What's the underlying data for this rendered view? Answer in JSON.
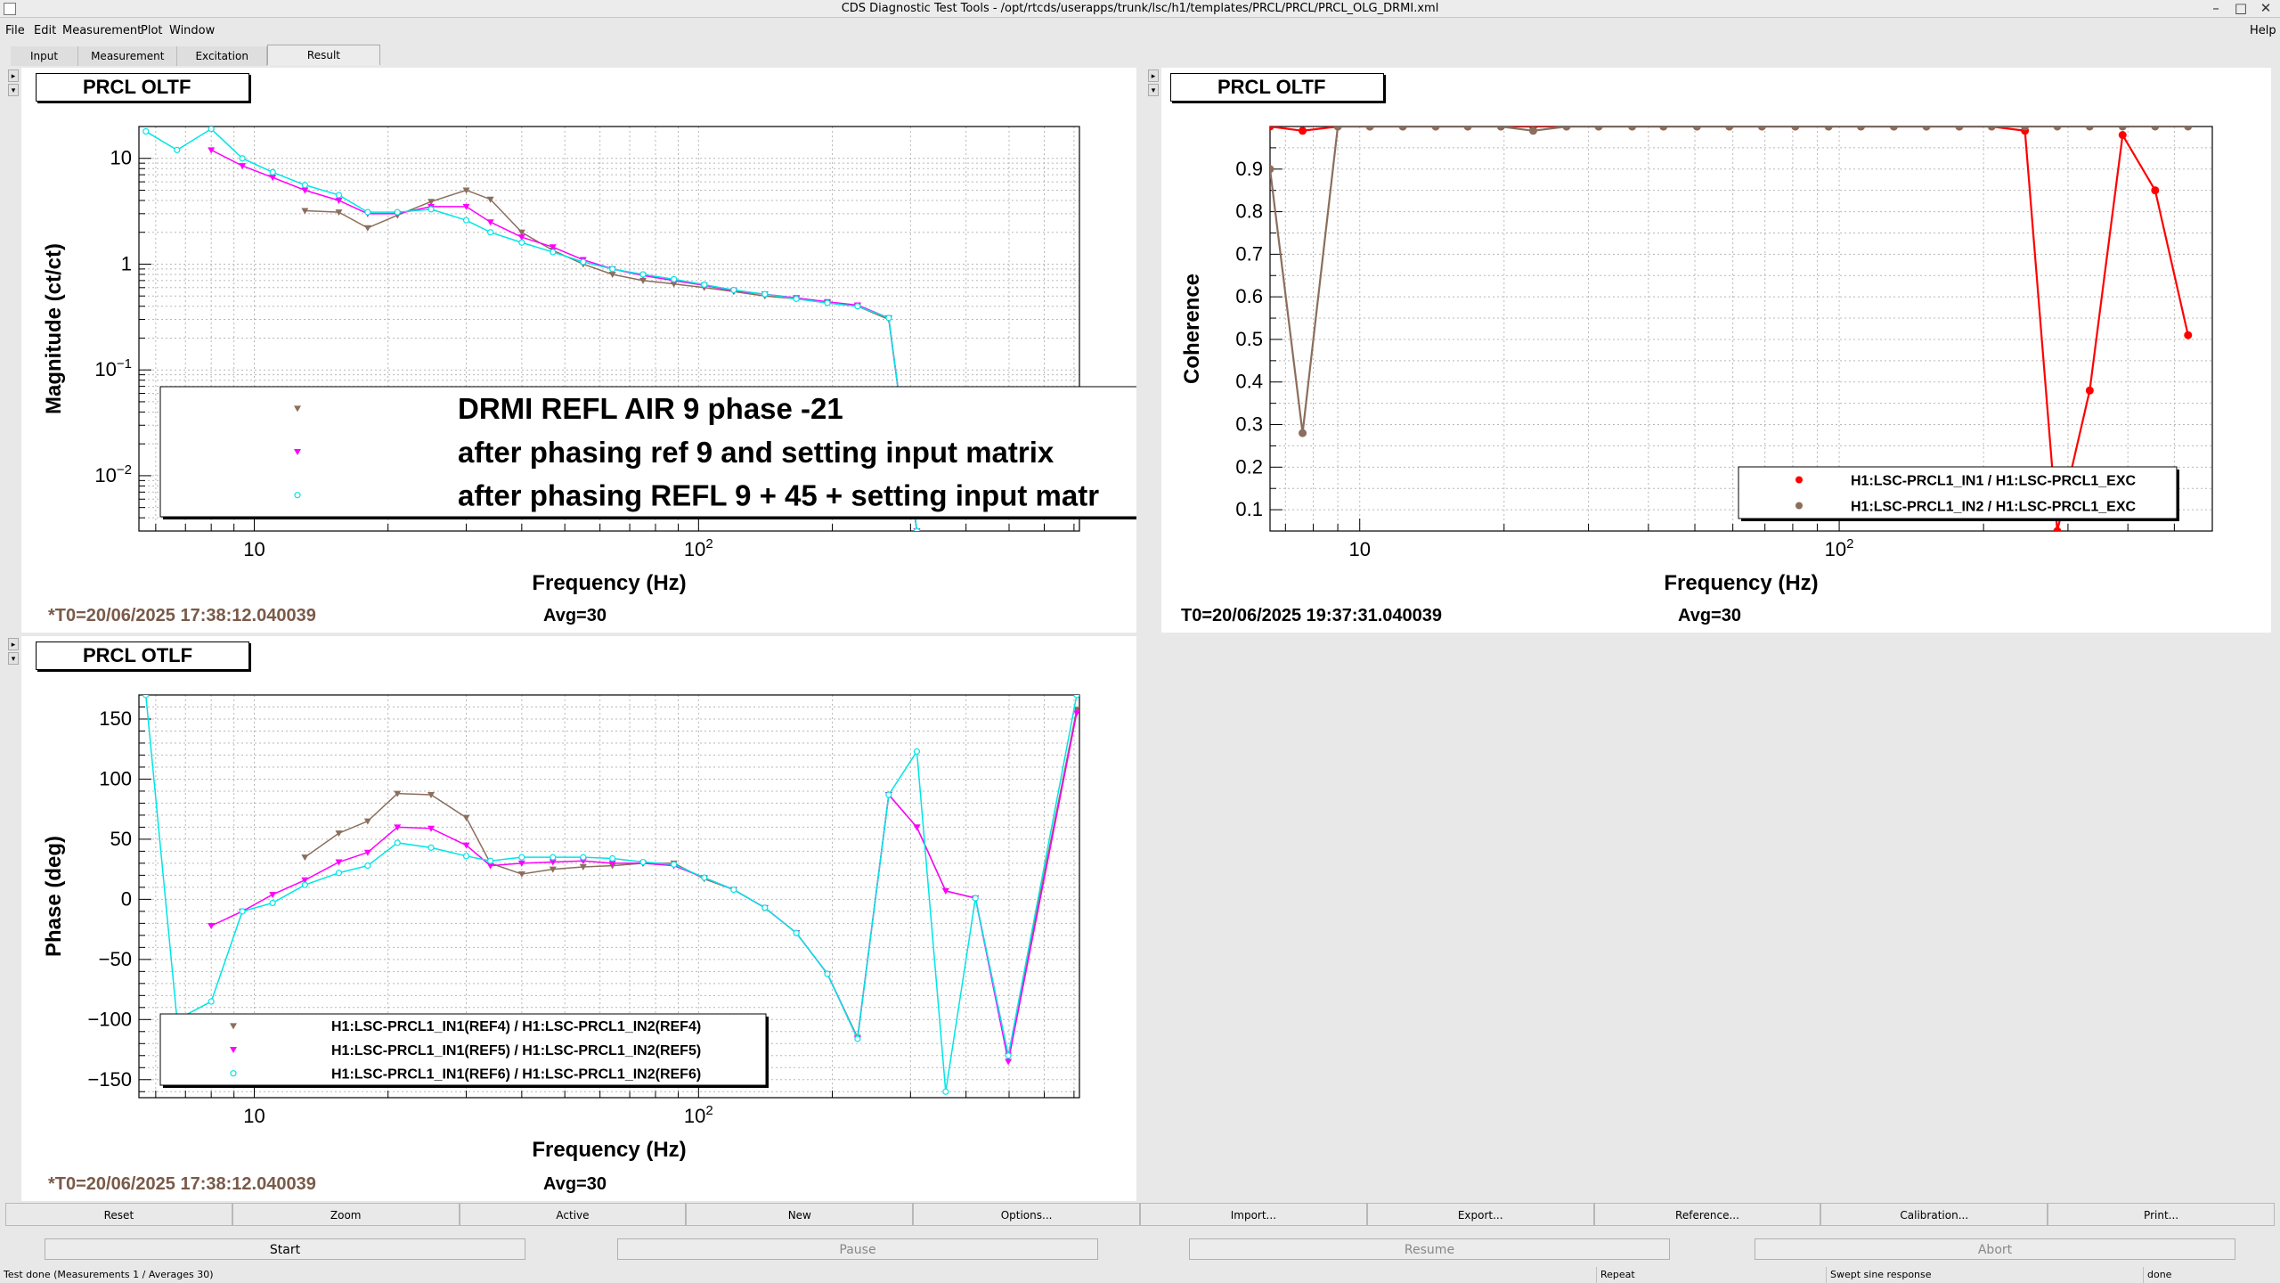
{
  "window": {
    "title": "CDS Diagnostic Test Tools - /opt/rtcds/userapps/trunk/lsc/h1/templates/PRCL/PRCL/PRCL_OLG_DRMI.xml"
  },
  "menu": {
    "file": "File",
    "edit": "Edit",
    "measurement": "Measurement",
    "plot": "Plot",
    "window": "Window",
    "help": "Help"
  },
  "tabs": [
    "Input",
    "Measurement",
    "Excitation",
    "Result"
  ],
  "active_tab": "Result",
  "panels": {
    "magnitude": {
      "title": "PRCL OLTF",
      "t0": "*T0=20/06/2025 17:38:12.040039",
      "avg": "Avg=30",
      "legend": [
        "DRMI REFL AIR 9 phase -21",
        "after phasing ref 9 and setting input matrix",
        "after phasing REFL 9 + 45 + setting input matr"
      ]
    },
    "coherence": {
      "title": "PRCL OLTF",
      "t0": "T0=20/06/2025 19:37:31.040039",
      "avg": "Avg=30",
      "legend": [
        "H1:LSC-PRCL1_IN1 / H1:LSC-PRCL1_EXC",
        "H1:LSC-PRCL1_IN2 / H1:LSC-PRCL1_EXC"
      ]
    },
    "phase": {
      "title": "PRCL OTLF",
      "t0": "*T0=20/06/2025 17:38:12.040039",
      "avg": "Avg=30",
      "legend": [
        "H1:LSC-PRCL1_IN1(REF4) / H1:LSC-PRCL1_IN2(REF4)",
        "H1:LSC-PRCL1_IN1(REF5) / H1:LSC-PRCL1_IN2(REF5)",
        "H1:LSC-PRCL1_IN1(REF6) / H1:LSC-PRCL1_IN2(REF6)"
      ]
    }
  },
  "toolbar": [
    "Reset",
    "Zoom",
    "Active",
    "New",
    "Options...",
    "Import...",
    "Export...",
    "Reference...",
    "Calibration...",
    "Print..."
  ],
  "controls": {
    "start": "Start",
    "pause": "Pause",
    "resume": "Resume",
    "abort": "Abort"
  },
  "status": {
    "message": "Test done (Measurements 1 / Averages 30)",
    "mode": "Repeat",
    "type": "Swept sine response",
    "state": "done"
  },
  "colors": {
    "ref4": "#8b6e5c",
    "ref5": "#ff00ff",
    "ref6": "#00e5e5",
    "in1": "#ff0000",
    "in2": "#8b6e5c"
  },
  "chart_data": [
    {
      "type": "line",
      "xscale": "log",
      "yscale": "log",
      "xlabel": "Frequency (Hz)",
      "ylabel": "Magnitude (ct/ct)",
      "xlim": [
        5.5,
        720
      ],
      "ylim": [
        0.003,
        20
      ],
      "xticks": [
        "10",
        "10^2"
      ],
      "yticks": [
        "10",
        "1",
        "10^-1",
        "10^-2"
      ],
      "series": [
        {
          "name": "DRMI REFL AIR 9 phase -21",
          "color": "#8b6e5c",
          "marker": "triangle-down",
          "x": [
            13,
            15.5,
            18,
            21,
            25,
            30,
            34,
            40,
            47,
            55,
            64,
            75,
            88,
            103,
            120,
            141,
            166,
            195,
            228,
            268,
            310
          ],
          "y": [
            3.2,
            3.1,
            2.2,
            2.9,
            3.9,
            5.0,
            4.1,
            2.0,
            1.35,
            1.0,
            0.8,
            0.7,
            0.65,
            0.6,
            0.55,
            0.5,
            0.47,
            0.43,
            0.4,
            0.3,
            0.003
          ]
        },
        {
          "name": "after phasing ref 9 and setting input matrix",
          "color": "#ff00ff",
          "marker": "triangle-down",
          "x": [
            8,
            9.4,
            11,
            13,
            15.5,
            18,
            21,
            25,
            30,
            34,
            40,
            47,
            55,
            64,
            75,
            88,
            103,
            120,
            141,
            166,
            195,
            228,
            268,
            310
          ],
          "y": [
            12,
            8.5,
            6.6,
            5.0,
            4.0,
            3.0,
            3.0,
            3.5,
            3.5,
            2.5,
            1.8,
            1.45,
            1.1,
            0.9,
            0.78,
            0.7,
            0.63,
            0.56,
            0.52,
            0.48,
            0.44,
            0.41,
            0.31,
            0.003
          ]
        },
        {
          "name": "after phasing REFL 9 + 45 + setting input matr",
          "color": "#00e5e5",
          "marker": "circle",
          "x": [
            5.7,
            6.7,
            8,
            9.4,
            11,
            13,
            15.5,
            18,
            21,
            25,
            30,
            34,
            40,
            47,
            55,
            64,
            75,
            88,
            103,
            120,
            141,
            166,
            195,
            228,
            268,
            310
          ],
          "y": [
            18,
            12,
            19,
            10,
            7.4,
            5.6,
            4.5,
            3.1,
            3.1,
            3.3,
            2.6,
            2.0,
            1.6,
            1.3,
            1.05,
            0.9,
            0.8,
            0.72,
            0.64,
            0.57,
            0.52,
            0.47,
            0.43,
            0.4,
            0.31,
            0.003
          ]
        }
      ]
    },
    {
      "type": "line",
      "xscale": "log",
      "xlabel": "Frequency (Hz)",
      "ylabel": "Coherence",
      "xlim": [
        6.5,
        600
      ],
      "ylim": [
        0.05,
        1.0
      ],
      "yticks": [
        "0.1",
        "0.2",
        "0.3",
        "0.4",
        "0.5",
        "0.6",
        "0.7",
        "0.8",
        "0.9"
      ],
      "series": [
        {
          "name": "H1:LSC-PRCL1_IN1 / H1:LSC-PRCL1_EXC",
          "color": "#ff0000",
          "x": [
            6.5,
            7.6,
            9,
            10.5,
            12.3,
            14.4,
            16.8,
            19.7,
            23,
            27,
            31.5,
            37,
            43,
            50.5,
            59,
            69,
            81,
            95,
            111,
            130,
            152,
            178,
            208,
            244,
            285,
            333,
            390,
            456,
            534
          ],
          "y": [
            1.0,
            0.99,
            1.0,
            1.0,
            1.0,
            1.0,
            1.0,
            1.0,
            1.0,
            1.0,
            1.0,
            1.0,
            1.0,
            1.0,
            1.0,
            1.0,
            1.0,
            1.0,
            1.0,
            1.0,
            1.0,
            1.0,
            1.0,
            0.99,
            0.05,
            0.38,
            0.98,
            0.85,
            0.51
          ]
        },
        {
          "name": "H1:LSC-PRCL1_IN2 / H1:LSC-PRCL1_EXC",
          "color": "#8b6e5c",
          "x": [
            6.5,
            7.6,
            9,
            10.5,
            12.3,
            14.4,
            16.8,
            19.7,
            23,
            27,
            31.5,
            37,
            43,
            50.5,
            59,
            69,
            81,
            95,
            111,
            130,
            152,
            178,
            208,
            244,
            285,
            333,
            390,
            456,
            534
          ],
          "y": [
            0.9,
            0.28,
            1.0,
            1.0,
            1.0,
            1.0,
            1.0,
            1.0,
            0.99,
            1.0,
            1.0,
            1.0,
            1.0,
            1.0,
            1.0,
            1.0,
            1.0,
            1.0,
            1.0,
            1.0,
            1.0,
            1.0,
            1.0,
            1.0,
            1.0,
            1.0,
            1.0,
            1.0,
            1.0
          ]
        }
      ]
    },
    {
      "type": "line",
      "xscale": "log",
      "xlabel": "Frequency (Hz)",
      "ylabel": "Phase (deg)",
      "xlim": [
        5.5,
        720
      ],
      "ylim": [
        -165,
        170
      ],
      "yticks": [
        "150",
        "100",
        "50",
        "0",
        "−50",
        "−100",
        "−150"
      ],
      "series": [
        {
          "name": "H1:LSC-PRCL1_IN1(REF4) / H1:LSC-PRCL1_IN2(REF4)",
          "color": "#8b6e5c",
          "marker": "triangle-down",
          "x": [
            13,
            15.5,
            18,
            21,
            25,
            30,
            34,
            40,
            47,
            55,
            64,
            75,
            88,
            103,
            120,
            141,
            166,
            195,
            228,
            268,
            310,
            360,
            420,
            498,
            710
          ],
          "y": [
            35,
            55,
            65,
            88,
            87,
            68,
            30,
            21,
            25,
            27,
            28,
            30,
            30,
            17,
            8,
            -7,
            -28,
            -62,
            -115,
            87,
            60,
            7,
            1,
            -130,
            158
          ]
        },
        {
          "name": "H1:LSC-PRCL1_IN1(REF5) / H1:LSC-PRCL1_IN2(REF5)",
          "color": "#ff00ff",
          "marker": "triangle-down",
          "x": [
            8,
            9.4,
            11,
            13,
            15.5,
            18,
            21,
            25,
            30,
            34,
            40,
            47,
            55,
            64,
            75,
            88,
            103,
            120,
            141,
            166,
            195,
            228,
            268,
            310,
            360,
            420,
            498,
            710
          ],
          "y": [
            -22,
            -10,
            4,
            16,
            31,
            39,
            60,
            59,
            45,
            28,
            30,
            31,
            32,
            30,
            30,
            28,
            18,
            8,
            -7,
            -28,
            -62,
            -116,
            87,
            60,
            7,
            1,
            -135,
            155
          ]
        },
        {
          "name": "H1:LSC-PRCL1_IN1(REF6) / H1:LSC-PRCL1_IN2(REF6)",
          "color": "#00e5e5",
          "marker": "circle",
          "x": [
            5.7,
            6.7,
            8,
            9.4,
            11,
            13,
            15.5,
            18,
            21,
            25,
            30,
            34,
            40,
            47,
            55,
            64,
            75,
            88,
            103,
            120,
            141,
            166,
            195,
            228,
            268,
            310,
            360,
            420,
            498,
            710
          ],
          "y": [
            170,
            -100,
            -85,
            -10,
            -3,
            12,
            22,
            28,
            47,
            43,
            36,
            32,
            35,
            35,
            35,
            34,
            31,
            29,
            18,
            8,
            -7,
            -28,
            -62,
            -116,
            87,
            123,
            -160,
            1,
            -130,
            170
          ]
        }
      ]
    }
  ]
}
